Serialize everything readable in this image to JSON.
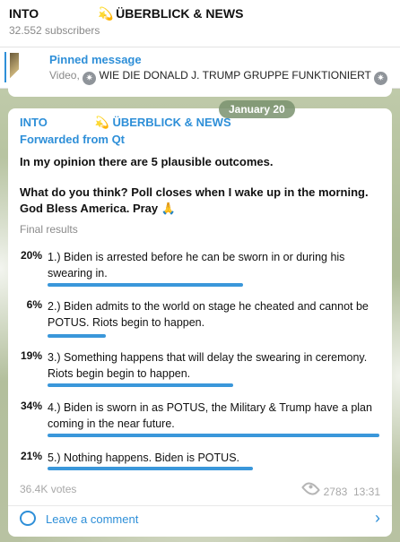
{
  "channel": {
    "title_left": "INTO",
    "title_right": "ÜBERBLICK & NEWS",
    "subscribers": "32.552 subscribers"
  },
  "pinned": {
    "label": "Pinned message",
    "prefix": "Video,",
    "text": "WIE DIE DONALD J. TRUMP GRUPPE FUNKTIONIERT"
  },
  "date_pill": "January 20",
  "message": {
    "channel_left": "INTO",
    "channel_right": "ÜBERBLICK & NEWS",
    "forwarded": "Forwarded from Qt",
    "intro": "In my opinion there are 5 plausible outcomes.",
    "question": "What do you think? Poll closes when I wake up in the morning. God Bless America. Pray 🙏",
    "final_results": "Final results",
    "options": [
      {
        "percent": "20%",
        "value": 20,
        "text": "1.) Biden is arrested before he can be sworn in or during his swearing in."
      },
      {
        "percent": "6%",
        "value": 6,
        "text": "2.) Biden admits to the world on stage he cheated and cannot be POTUS. Riots begin to happen."
      },
      {
        "percent": "19%",
        "value": 19,
        "text": "3.) Something happens that will delay the swearing in ceremony. Riots begin begin to happen."
      },
      {
        "percent": "34%",
        "value": 34,
        "text": "4.) Biden is sworn in as POTUS, the Military & Trump have a plan coming in the near future."
      },
      {
        "percent": "21%",
        "value": 21,
        "text": "5.) Nothing happens. Biden is POTUS."
      }
    ],
    "votes": "36.4K votes",
    "views": "2783",
    "time": "13:31",
    "leave_comment": "Leave a comment"
  },
  "colors": {
    "accent": "#2e8fd8",
    "poll_bar": "#3a97da"
  },
  "icons": [
    "gear-icon",
    "eye-icon",
    "comment-icon",
    "chevron-right-icon",
    "shooting-star-icon",
    "pray-icon"
  ]
}
